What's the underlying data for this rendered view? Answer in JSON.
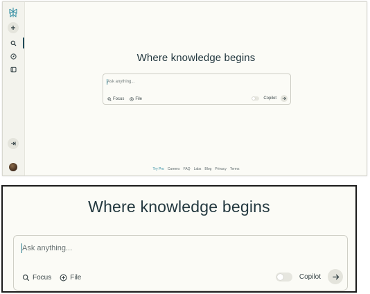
{
  "hero": {
    "title": "Where knowledge begins"
  },
  "ask": {
    "placeholder": "Ask anything..."
  },
  "tools": {
    "focus_label": "Focus",
    "file_label": "File"
  },
  "copilot": {
    "label": "Copilot",
    "enabled": false
  },
  "footer": {
    "links": [
      "Try Pro",
      "Careers",
      "FAQ",
      "Labs",
      "Blog",
      "Privacy",
      "Terms"
    ]
  },
  "sidebar": {
    "icons": [
      "logo-icon",
      "plus-icon",
      "search-icon",
      "compass-icon",
      "library-icon",
      "collapse-icon",
      "avatar"
    ]
  },
  "colors": {
    "accent": "#2a8aa0",
    "background": "#fbfbf6",
    "sidebar": "#f3f3ed"
  }
}
